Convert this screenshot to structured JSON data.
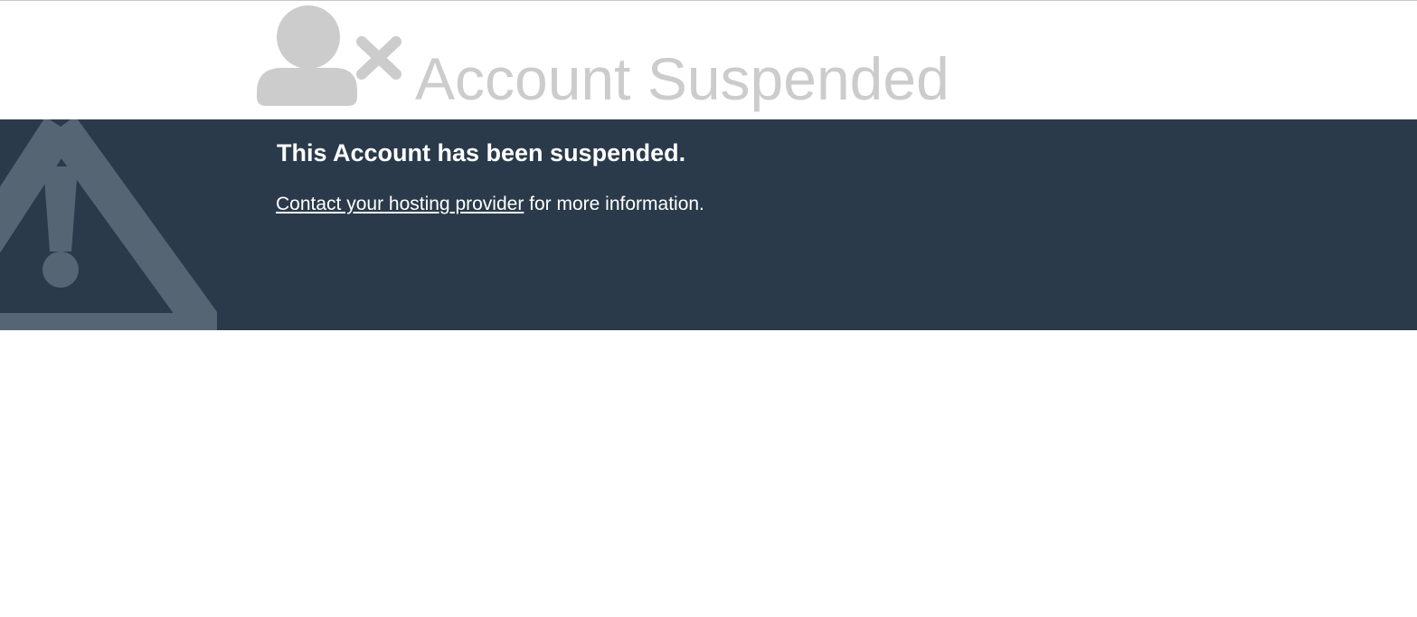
{
  "header": {
    "title": "Account Suspended",
    "icon": "user-x-icon"
  },
  "banner": {
    "heading": "This Account has been suspended.",
    "link_text": "Contact your hosting provider",
    "suffix_text": " for more information.",
    "icon": "warning-icon"
  },
  "colors": {
    "banner_background": "#2a3a4a",
    "muted_icon": "#cccccc",
    "warning_icon": "#566574",
    "text_light": "#ffffff"
  }
}
